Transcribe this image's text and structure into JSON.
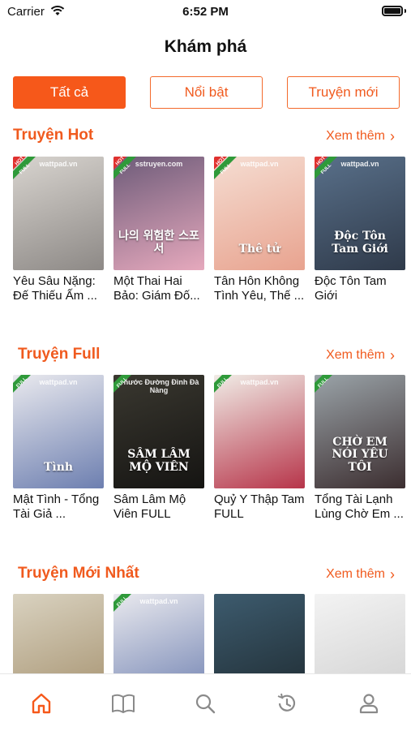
{
  "status_bar": {
    "carrier": "Carrier",
    "time": "6:52 PM"
  },
  "header": {
    "title": "Khám phá"
  },
  "tabs": [
    {
      "label": "Tất cả",
      "active": true
    },
    {
      "label": "Nổi bật",
      "active": false
    },
    {
      "label": "Truyện mới",
      "active": false
    }
  ],
  "sections": [
    {
      "title": "Truyện Hot",
      "more_label": "Xem thêm",
      "books": [
        {
          "title": "Yêu Sâu Nặng: Đế Thiếu Ấm ...",
          "badge": "HOT",
          "ribbon": "FULL",
          "cover_watermark": "wattpad.vn",
          "cover_colors": [
            "#d8d4cf",
            "#8d8986"
          ],
          "cover_text": ""
        },
        {
          "title": "Một Thai Hai Bảo: Giám Đố...",
          "badge": "HOT",
          "ribbon": "FULL",
          "cover_watermark": "sstruyen.com",
          "cover_colors": [
            "#6d5b79",
            "#e6a9bd"
          ],
          "cover_text": "나의 위험한 스포서"
        },
        {
          "title": "Tân Hôn Không Tình Yêu, Thế ...",
          "badge": "HOT",
          "ribbon": "FULL",
          "cover_watermark": "wattpad.vn",
          "cover_colors": [
            "#f5ddd2",
            "#e8a38f"
          ],
          "cover_text": "Thê tử"
        },
        {
          "title": "Độc Tôn Tam Giới",
          "badge": "HOT",
          "ribbon": "FULL",
          "cover_watermark": "wattpad.vn",
          "cover_colors": [
            "#59708a",
            "#2f3a4a"
          ],
          "cover_text": "Độc Tôn Tam Giới"
        }
      ]
    },
    {
      "title": "Truyện Full",
      "more_label": "Xem thêm",
      "books": [
        {
          "title": "Mật Tình - Tổng Tài Giả ...",
          "badge": "",
          "ribbon": "FULL",
          "cover_watermark": "wattpad.vn",
          "cover_colors": [
            "#e9e9ee",
            "#6d7fb0"
          ],
          "cover_text": "Tình"
        },
        {
          "title": "Sâm Lâm Mộ Viên FULL",
          "badge": "",
          "ribbon": "FULL",
          "cover_watermark": "Phước Đường Đình Đà Nàng",
          "cover_colors": [
            "#3a3830",
            "#151412"
          ],
          "cover_text": "SÂM LÂM MỘ VIÊN"
        },
        {
          "title": "Quỷ Y Thập Tam FULL",
          "badge": "",
          "ribbon": "FULL",
          "cover_watermark": "wattpad.vn",
          "cover_colors": [
            "#f0ece6",
            "#b7354a"
          ],
          "cover_text": ""
        },
        {
          "title": "Tổng Tài Lạnh Lùng Chờ Em ...",
          "badge": "",
          "ribbon": "FULL",
          "cover_watermark": "",
          "cover_colors": [
            "#9aa3a8",
            "#3c2e30"
          ],
          "cover_text": "CHỜ EM NÓI YÊU TÔI"
        }
      ]
    },
    {
      "title": "Truyện Mới Nhất",
      "more_label": "Xem thêm",
      "books": [
        {
          "title": "",
          "badge": "",
          "ribbon": "",
          "cover_watermark": "",
          "cover_colors": [
            "#d9d2c0",
            "#a5916e"
          ],
          "cover_text": ""
        },
        {
          "title": "",
          "badge": "",
          "ribbon": "FULL",
          "cover_watermark": "wattpad.vn",
          "cover_colors": [
            "#e9e9ee",
            "#6d7fb0"
          ],
          "cover_text": ""
        },
        {
          "title": "",
          "badge": "",
          "ribbon": "",
          "cover_watermark": "",
          "cover_colors": [
            "#3d5b6e",
            "#1e2a30"
          ],
          "cover_text": ""
        },
        {
          "title": "",
          "badge": "",
          "ribbon": "",
          "cover_watermark": "",
          "cover_colors": [
            "#f3f3f3",
            "#cfcfcf"
          ],
          "cover_text": ""
        }
      ]
    }
  ],
  "bottom_nav": [
    {
      "icon": "home-icon",
      "active": true
    },
    {
      "icon": "book-icon",
      "active": false
    },
    {
      "icon": "search-icon",
      "active": false
    },
    {
      "icon": "history-icon",
      "active": false
    },
    {
      "icon": "profile-icon",
      "active": false
    }
  ],
  "colors": {
    "accent": "#f6581a",
    "inactive_icon": "#8a8a8a"
  }
}
